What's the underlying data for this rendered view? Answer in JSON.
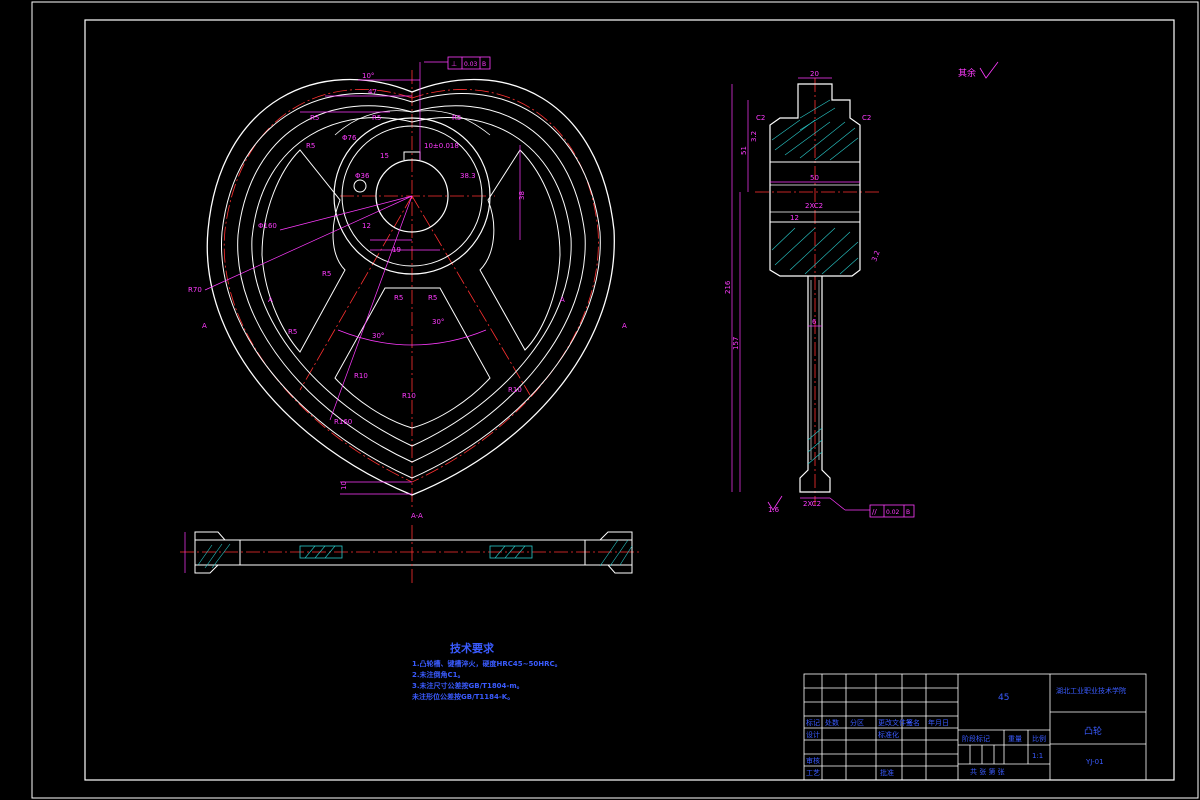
{
  "colors": {
    "background": "#000000",
    "outline": "#ffffff",
    "dimension": "#ff3bff",
    "centerline": "#ff3030",
    "hatch": "#29c9c9",
    "text": "#3a5bff"
  },
  "front_view": {
    "dims": {
      "angle_top": "10°",
      "w47": "47",
      "r5_a": "R5",
      "r5_b": "R5",
      "r5_c": "R5",
      "r5_d": "R5",
      "r5_e": "R5",
      "r5_f": "R5",
      "r5_g": "R5",
      "r5_h": "R5",
      "phi76": "Φ76",
      "phi36": "Φ36",
      "keyway": "10±0.018",
      "phi160": "Φ160",
      "r70": "R70",
      "r10_a": "R10",
      "r10_b": "R10",
      "r10_c": "R10",
      "r160": "R160",
      "ang30_a": "30°",
      "ang30_b": "30°",
      "d19": "19",
      "d38": "38",
      "d385": "38.3",
      "d15": "15",
      "d12": "12",
      "d10": "10",
      "section_a1": "A",
      "section_a2": "A",
      "section_a3": "A",
      "section_a4": "A",
      "section_label": "A-A"
    },
    "tolerance_frame": {
      "symbol": "⊥",
      "value": "0.03",
      "datum": "B"
    }
  },
  "side_view": {
    "dims": {
      "w20": "20",
      "w50": "50",
      "c2_a": "C2",
      "c2_b": "C2",
      "c2x_a": "2XC2",
      "c2x_b": "2XC2",
      "d51": "51",
      "d12": "12",
      "d157": "157",
      "d216": "216",
      "d32": "3.2",
      "d32b": "3.2",
      "d6": "6",
      "d16": "1.6"
    },
    "tolerance_frame": {
      "symbol": "//",
      "value": "0.02",
      "datum": "B"
    }
  },
  "surface_note": {
    "label": "其余"
  },
  "tech_notes": {
    "title": "技术要求",
    "lines": [
      "1.凸轮槽、键槽淬火，硬度HRC45~50HRC。",
      "2.未注倒角C1。",
      "3.未注尺寸公差按GB/T1804-m。",
      "未注形位公差按GB/T1184-K。"
    ]
  },
  "title_block": {
    "material": "45",
    "school": "湖北工业职业技术学院",
    "part_name": "凸轮",
    "drawing_no": "YJ-01",
    "scale": "1:1",
    "sheet": "共 张 第 张",
    "row_labels": [
      "标记",
      "处数",
      "分区",
      "更改文件号",
      "签名",
      "年月日"
    ],
    "row2": [
      "设计",
      "标准化",
      "阶段标记",
      "重量",
      "比例"
    ],
    "row3": [
      "审核"
    ],
    "row4": [
      "工艺",
      "批准"
    ]
  }
}
